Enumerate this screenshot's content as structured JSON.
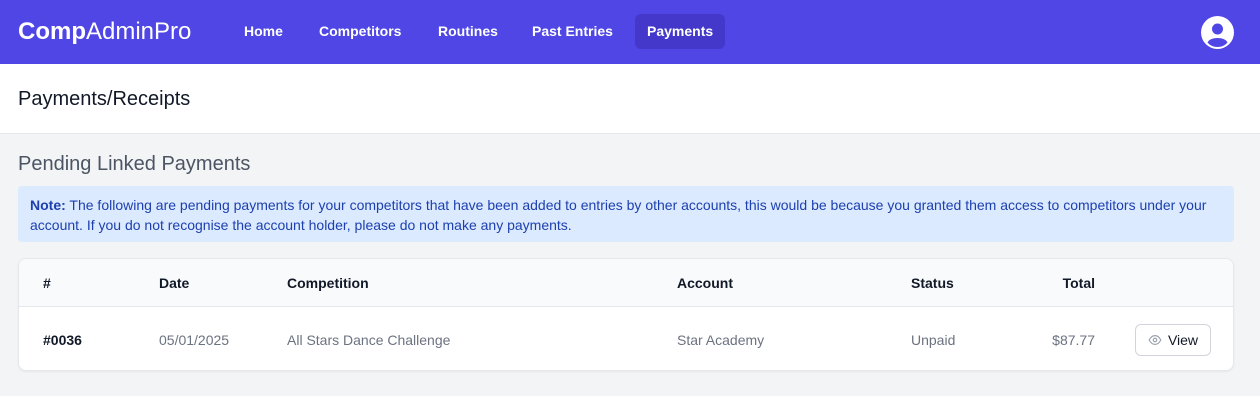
{
  "brand": {
    "bold": "Comp",
    "light": "AdminPro"
  },
  "nav": {
    "items": [
      {
        "label": "Home"
      },
      {
        "label": "Competitors"
      },
      {
        "label": "Routines"
      },
      {
        "label": "Past Entries"
      },
      {
        "label": "Payments",
        "active": true
      }
    ],
    "avatar_icon": "user-circle-icon"
  },
  "header": {
    "title": "Payments/Receipts"
  },
  "section": {
    "title": "Pending Linked Payments"
  },
  "note": {
    "label": "Note:",
    "text": " The following are pending payments for your competitors that have been added to entries by other accounts, this would be because you granted them access to competitors under your account. If you do not recognise the account holder, please do not make any payments."
  },
  "table": {
    "columns": [
      "#",
      "Date",
      "Competition",
      "Account",
      "Status",
      "Total"
    ],
    "rows": [
      {
        "id": "#0036",
        "date": "05/01/2025",
        "competition": "All Stars Dance Challenge",
        "account": "Star Academy",
        "status": "Unpaid",
        "total": "$87.77",
        "action": "View",
        "action_icon": "eye-icon"
      }
    ]
  },
  "colors": {
    "nav_bg": "#4f46e5",
    "nav_active": "#4338ca",
    "note_bg": "#dbeafe",
    "note_text": "#1e40af"
  }
}
